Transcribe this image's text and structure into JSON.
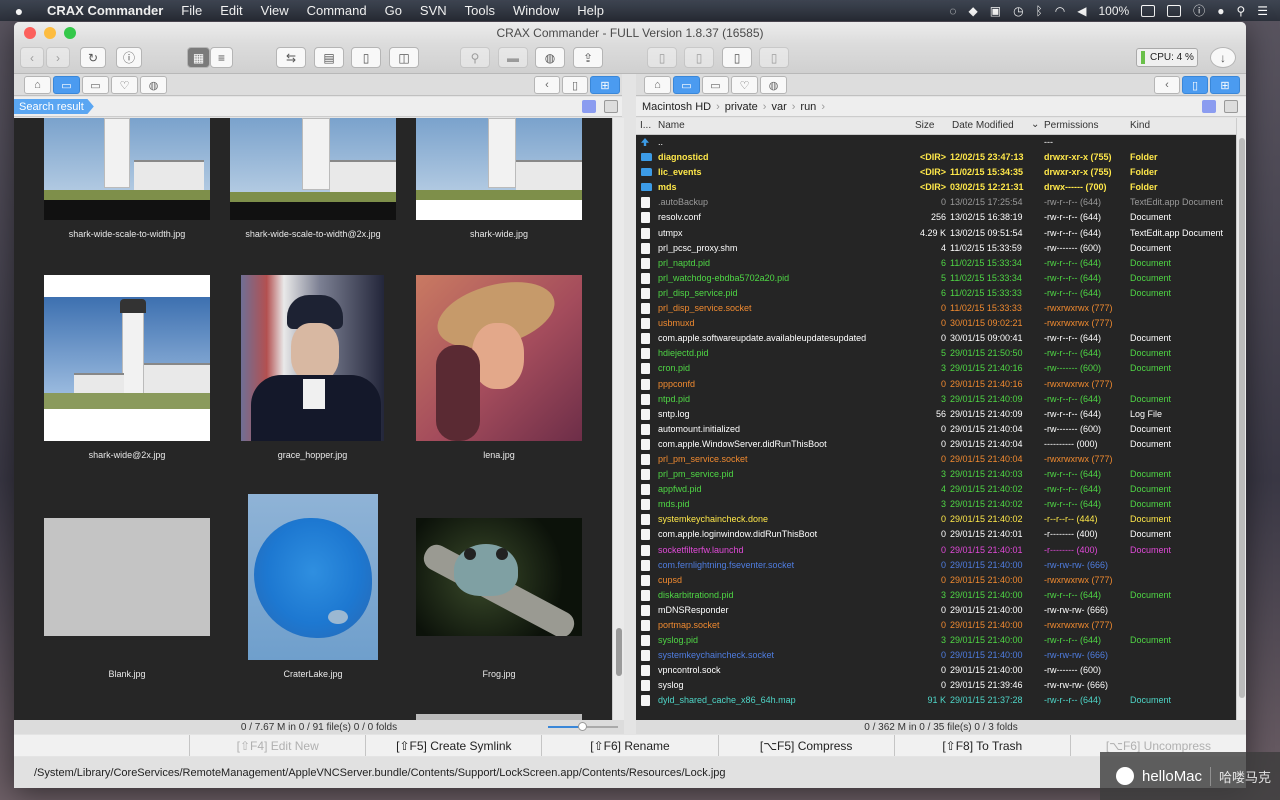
{
  "menubar": {
    "app": "CRAX Commander",
    "items": [
      "File",
      "Edit",
      "View",
      "Command",
      "Go",
      "SVN",
      "Tools",
      "Window",
      "Help"
    ],
    "battery": "100%"
  },
  "window": {
    "title": "CRAX Commander - FULL Version 1.8.37 (16585)",
    "cpu": "CPU: 4 %"
  },
  "left": {
    "badge": "Search result",
    "status": "0 / 7.67 M in 0 / 91 file(s) 0 / 0 folds",
    "thumbs": [
      {
        "name": "shark-wide-scale-to-width.jpg"
      },
      {
        "name": "shark-wide-scale-to-width@2x.jpg"
      },
      {
        "name": "shark-wide.jpg"
      },
      {
        "name": "shark-wide@2x.jpg"
      },
      {
        "name": "grace_hopper.jpg"
      },
      {
        "name": "lena.jpg"
      },
      {
        "name": "Blank.jpg"
      },
      {
        "name": "CraterLake.jpg"
      },
      {
        "name": "Frog.jpg"
      }
    ]
  },
  "right": {
    "path": [
      "Macintosh HD",
      "private",
      "var",
      "run"
    ],
    "status": "0 / 362 M in 0 / 35 file(s) 0 / 3 folds",
    "columns": {
      "icon": "I...",
      "name": "Name",
      "size": "Size",
      "date": "Date Modified",
      "perm": "Permissions",
      "kind": "Kind"
    },
    "files": [
      {
        "t": "up",
        "name": "..",
        "size": "",
        "date": "",
        "perm": "---",
        "kind": "",
        "c": "#ffffff"
      },
      {
        "t": "dir",
        "name": "diagnosticd",
        "size": "<DIR>",
        "date": "12/02/15 23:47:13",
        "perm": "drwxr-xr-x (755)",
        "kind": "Folder",
        "c": "#ffe84a",
        "bold": true
      },
      {
        "t": "dir",
        "name": "lic_events",
        "size": "<DIR>",
        "date": "11/02/15 15:34:35",
        "perm": "drwxr-xr-x (755)",
        "kind": "Folder",
        "c": "#ffe84a",
        "bold": true
      },
      {
        "t": "dir",
        "name": "mds",
        "size": "<DIR>",
        "date": "03/02/15 12:21:31",
        "perm": "drwx------ (700)",
        "kind": "Folder",
        "c": "#ffe84a",
        "bold": true
      },
      {
        "t": "f",
        "name": ".autoBackup",
        "size": "0",
        "date": "13/02/15 17:25:54",
        "perm": "-rw-r--r-- (644)",
        "kind": "TextEdit.app Document",
        "c": "#9a9a9a"
      },
      {
        "t": "f",
        "name": "resolv.conf",
        "size": "256",
        "date": "13/02/15 16:38:19",
        "perm": "-rw-r--r-- (644)",
        "kind": "Document",
        "c": "#ffffff"
      },
      {
        "t": "f",
        "name": "utmpx",
        "size": "4.29 K",
        "date": "13/02/15 09:51:54",
        "perm": "-rw-r--r-- (644)",
        "kind": "TextEdit.app Document",
        "c": "#ffffff"
      },
      {
        "t": "f",
        "name": "prl_pcsc_proxy.shm",
        "size": "4",
        "date": "11/02/15 15:33:59",
        "perm": "-rw------- (600)",
        "kind": "Document",
        "c": "#ffffff"
      },
      {
        "t": "f",
        "name": "prl_naptd.pid",
        "size": "6",
        "date": "11/02/15 15:33:34",
        "perm": "-rw-r--r-- (644)",
        "kind": "Document",
        "c": "#4fd645"
      },
      {
        "t": "f",
        "name": "prl_watchdog-ebdba5702a20.pid",
        "size": "5",
        "date": "11/02/15 15:33:34",
        "perm": "-rw-r--r-- (644)",
        "kind": "Document",
        "c": "#4fd645"
      },
      {
        "t": "f",
        "name": "prl_disp_service.pid",
        "size": "6",
        "date": "11/02/15 15:33:33",
        "perm": "-rw-r--r-- (644)",
        "kind": "Document",
        "c": "#4fd645"
      },
      {
        "t": "f",
        "name": "prl_disp_service.socket",
        "size": "0",
        "date": "11/02/15 15:33:33",
        "perm": "-rwxrwxrwx (777)",
        "kind": "",
        "c": "#f08a30"
      },
      {
        "t": "f",
        "name": "usbmuxd",
        "size": "0",
        "date": "30/01/15 09:02:21",
        "perm": "-rwxrwxrwx (777)",
        "kind": "",
        "c": "#f08a30"
      },
      {
        "t": "f",
        "name": "com.apple.softwareupdate.availableupdatesupdated",
        "size": "0",
        "date": "30/01/15 09:00:41",
        "perm": "-rw-r--r-- (644)",
        "kind": "Document",
        "c": "#ffffff"
      },
      {
        "t": "f",
        "name": "hdiejectd.pid",
        "size": "5",
        "date": "29/01/15 21:50:50",
        "perm": "-rw-r--r-- (644)",
        "kind": "Document",
        "c": "#4fd645"
      },
      {
        "t": "f",
        "name": "cron.pid",
        "size": "3",
        "date": "29/01/15 21:40:16",
        "perm": "-rw------- (600)",
        "kind": "Document",
        "c": "#4fd645"
      },
      {
        "t": "f",
        "name": "pppconfd",
        "size": "0",
        "date": "29/01/15 21:40:16",
        "perm": "-rwxrwxrwx (777)",
        "kind": "",
        "c": "#f08a30"
      },
      {
        "t": "f",
        "name": "ntpd.pid",
        "size": "3",
        "date": "29/01/15 21:40:09",
        "perm": "-rw-r--r-- (644)",
        "kind": "Document",
        "c": "#4fd645"
      },
      {
        "t": "f",
        "name": "sntp.log",
        "size": "56",
        "date": "29/01/15 21:40:09",
        "perm": "-rw-r--r-- (644)",
        "kind": "Log File",
        "c": "#ffffff"
      },
      {
        "t": "f",
        "name": "automount.initialized",
        "size": "0",
        "date": "29/01/15 21:40:04",
        "perm": "-rw------- (600)",
        "kind": "Document",
        "c": "#ffffff"
      },
      {
        "t": "f",
        "name": "com.apple.WindowServer.didRunThisBoot",
        "size": "0",
        "date": "29/01/15 21:40:04",
        "perm": "---------- (000)",
        "kind": "Document",
        "c": "#ffffff"
      },
      {
        "t": "f",
        "name": "prl_pm_service.socket",
        "size": "0",
        "date": "29/01/15 21:40:04",
        "perm": "-rwxrwxrwx (777)",
        "kind": "",
        "c": "#f08a30"
      },
      {
        "t": "f",
        "name": "prl_pm_service.pid",
        "size": "3",
        "date": "29/01/15 21:40:03",
        "perm": "-rw-r--r-- (644)",
        "kind": "Document",
        "c": "#4fd645"
      },
      {
        "t": "f",
        "name": "appfwd.pid",
        "size": "4",
        "date": "29/01/15 21:40:02",
        "perm": "-rw-r--r-- (644)",
        "kind": "Document",
        "c": "#4fd645"
      },
      {
        "t": "f",
        "name": "mds.pid",
        "size": "3",
        "date": "29/01/15 21:40:02",
        "perm": "-rw-r--r-- (644)",
        "kind": "Document",
        "c": "#4fd645"
      },
      {
        "t": "f",
        "name": "systemkeychaincheck.done",
        "size": "0",
        "date": "29/01/15 21:40:02",
        "perm": "-r--r--r-- (444)",
        "kind": "Document",
        "c": "#ffe84a"
      },
      {
        "t": "f",
        "name": "com.apple.loginwindow.didRunThisBoot",
        "size": "0",
        "date": "29/01/15 21:40:01",
        "perm": "-r-------- (400)",
        "kind": "Document",
        "c": "#ffffff"
      },
      {
        "t": "f",
        "name": "socketfilterfw.launchd",
        "size": "0",
        "date": "29/01/15 21:40:01",
        "perm": "-r-------- (400)",
        "kind": "Document",
        "c": "#e04ad8"
      },
      {
        "t": "f",
        "name": "com.fernlightning.fseventer.socket",
        "size": "0",
        "date": "29/01/15 21:40:00",
        "perm": "-rw-rw-rw- (666)",
        "kind": "",
        "c": "#4f7de0"
      },
      {
        "t": "f",
        "name": "cupsd",
        "size": "0",
        "date": "29/01/15 21:40:00",
        "perm": "-rwxrwxrwx (777)",
        "kind": "",
        "c": "#f08a30"
      },
      {
        "t": "f",
        "name": "diskarbitrationd.pid",
        "size": "3",
        "date": "29/01/15 21:40:00",
        "perm": "-rw-r--r-- (644)",
        "kind": "Document",
        "c": "#4fd645"
      },
      {
        "t": "f",
        "name": "mDNSResponder",
        "size": "0",
        "date": "29/01/15 21:40:00",
        "perm": "-rw-rw-rw- (666)",
        "kind": "",
        "c": "#ffffff"
      },
      {
        "t": "f",
        "name": "portmap.socket",
        "size": "0",
        "date": "29/01/15 21:40:00",
        "perm": "-rwxrwxrwx (777)",
        "kind": "",
        "c": "#f08a30"
      },
      {
        "t": "f",
        "name": "syslog.pid",
        "size": "3",
        "date": "29/01/15 21:40:00",
        "perm": "-rw-r--r-- (644)",
        "kind": "Document",
        "c": "#4fd645"
      },
      {
        "t": "f",
        "name": "systemkeychaincheck.socket",
        "size": "0",
        "date": "29/01/15 21:40:00",
        "perm": "-rw-rw-rw- (666)",
        "kind": "",
        "c": "#4f7de0"
      },
      {
        "t": "f",
        "name": "vpncontrol.sock",
        "size": "0",
        "date": "29/01/15 21:40:00",
        "perm": "-rw------- (600)",
        "kind": "",
        "c": "#ffffff"
      },
      {
        "t": "f",
        "name": "syslog",
        "size": "0",
        "date": "29/01/15 21:39:46",
        "perm": "-rw-rw-rw- (666)",
        "kind": "",
        "c": "#ffffff"
      },
      {
        "t": "f",
        "name": "dyld_shared_cache_x86_64h.map",
        "size": "91 K",
        "date": "29/01/15 21:37:28",
        "perm": "-rw-r--r-- (644)",
        "kind": "Document",
        "c": "#4fd6c8"
      }
    ]
  },
  "fkeys": [
    {
      "label": "",
      "dis": true
    },
    {
      "label": "[⇧F4] Edit New",
      "dis": true
    },
    {
      "label": "[⇧F5] Create Symlink"
    },
    {
      "label": "[⇧F6] Rename"
    },
    {
      "label": "[⌥F5] Compress"
    },
    {
      "label": "[⇧F8] To Trash"
    },
    {
      "label": "[⌥F6] Uncompress",
      "dis": true
    }
  ],
  "pathbar": "/System/Library/CoreServices/RemoteManagement/AppleVNCServer.bundle/Contents/Support/LockScreen.app/Contents/Resources/Lock.jpg",
  "watermark": {
    "brand": "helloMac",
    "cn": "哈喽马克"
  }
}
